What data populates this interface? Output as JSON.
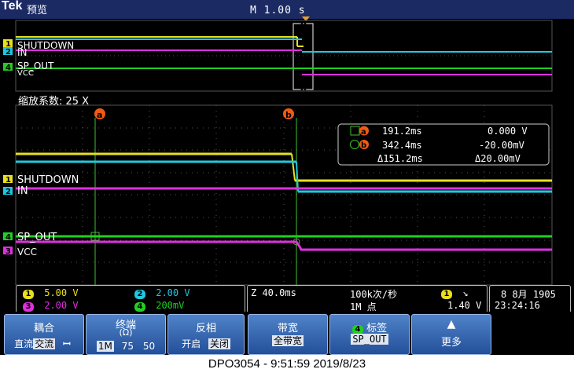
{
  "header": {
    "brand": "Tek",
    "mode": "预览",
    "timebase": "M 1.00 s"
  },
  "overview": {
    "labels": {
      "shutdown": "SHUTDOWN",
      "in": "IN",
      "sp_out": "SP_OUT",
      "vcc": "VCC"
    }
  },
  "zoom": {
    "label": "缩放系数: 25 X"
  },
  "cursors": {
    "a": "a",
    "b": "b"
  },
  "colors": {
    "ch1": "#e8e020",
    "ch2": "#20c8e0",
    "ch3": "#e030e0",
    "ch4": "#20d020",
    "cursor": "#f05a14"
  },
  "main": {
    "labels": {
      "shutdown": "SHUTDOWN",
      "in": "IN",
      "sp_out": "SP_OUT",
      "vcc": "VCC"
    }
  },
  "measure": {
    "a_time": "191.2ms",
    "a_volt": "0.000 V",
    "b_time": "342.4ms",
    "b_volt": "-20.00mV",
    "d_time": "Δ151.2ms",
    "d_volt": "Δ20.00mV"
  },
  "channels": {
    "ch1": {
      "num": "1",
      "scale": "5.00 V"
    },
    "ch2": {
      "num": "2",
      "scale": "2.00 V"
    },
    "ch3": {
      "num": "3",
      "scale": "2.00 V"
    },
    "ch4": {
      "num": "4",
      "scale": "200mV"
    }
  },
  "acq": {
    "zoom_time": "Z 40.0ms",
    "rate": "100k次/秒",
    "points": "1M 点"
  },
  "trigger": {
    "src": "1",
    "slope": "↘",
    "level": "1.40 V"
  },
  "datetime": {
    "date": "8 8月  1905",
    "time": "23:24:16"
  },
  "menu": {
    "coupling": {
      "title": "耦合",
      "opt1": "直流",
      "opt2": "交流",
      "opt3": "ꟷ"
    },
    "termination": {
      "title": "终端",
      "unit": "(Ω)",
      "opt1": "1M",
      "opt2": "75",
      "opt3": "50"
    },
    "invert": {
      "title": "反相",
      "opt1": "开启",
      "opt2": "关闭"
    },
    "bandwidth": {
      "title": "带宽",
      "value": "全带宽"
    },
    "label": {
      "num": "4",
      "title": "标签",
      "value": "SP_OUT"
    },
    "more": {
      "title": "更多"
    }
  },
  "footer": {
    "caption": "DPO3054 - 9:51:59   2019/8/23"
  }
}
